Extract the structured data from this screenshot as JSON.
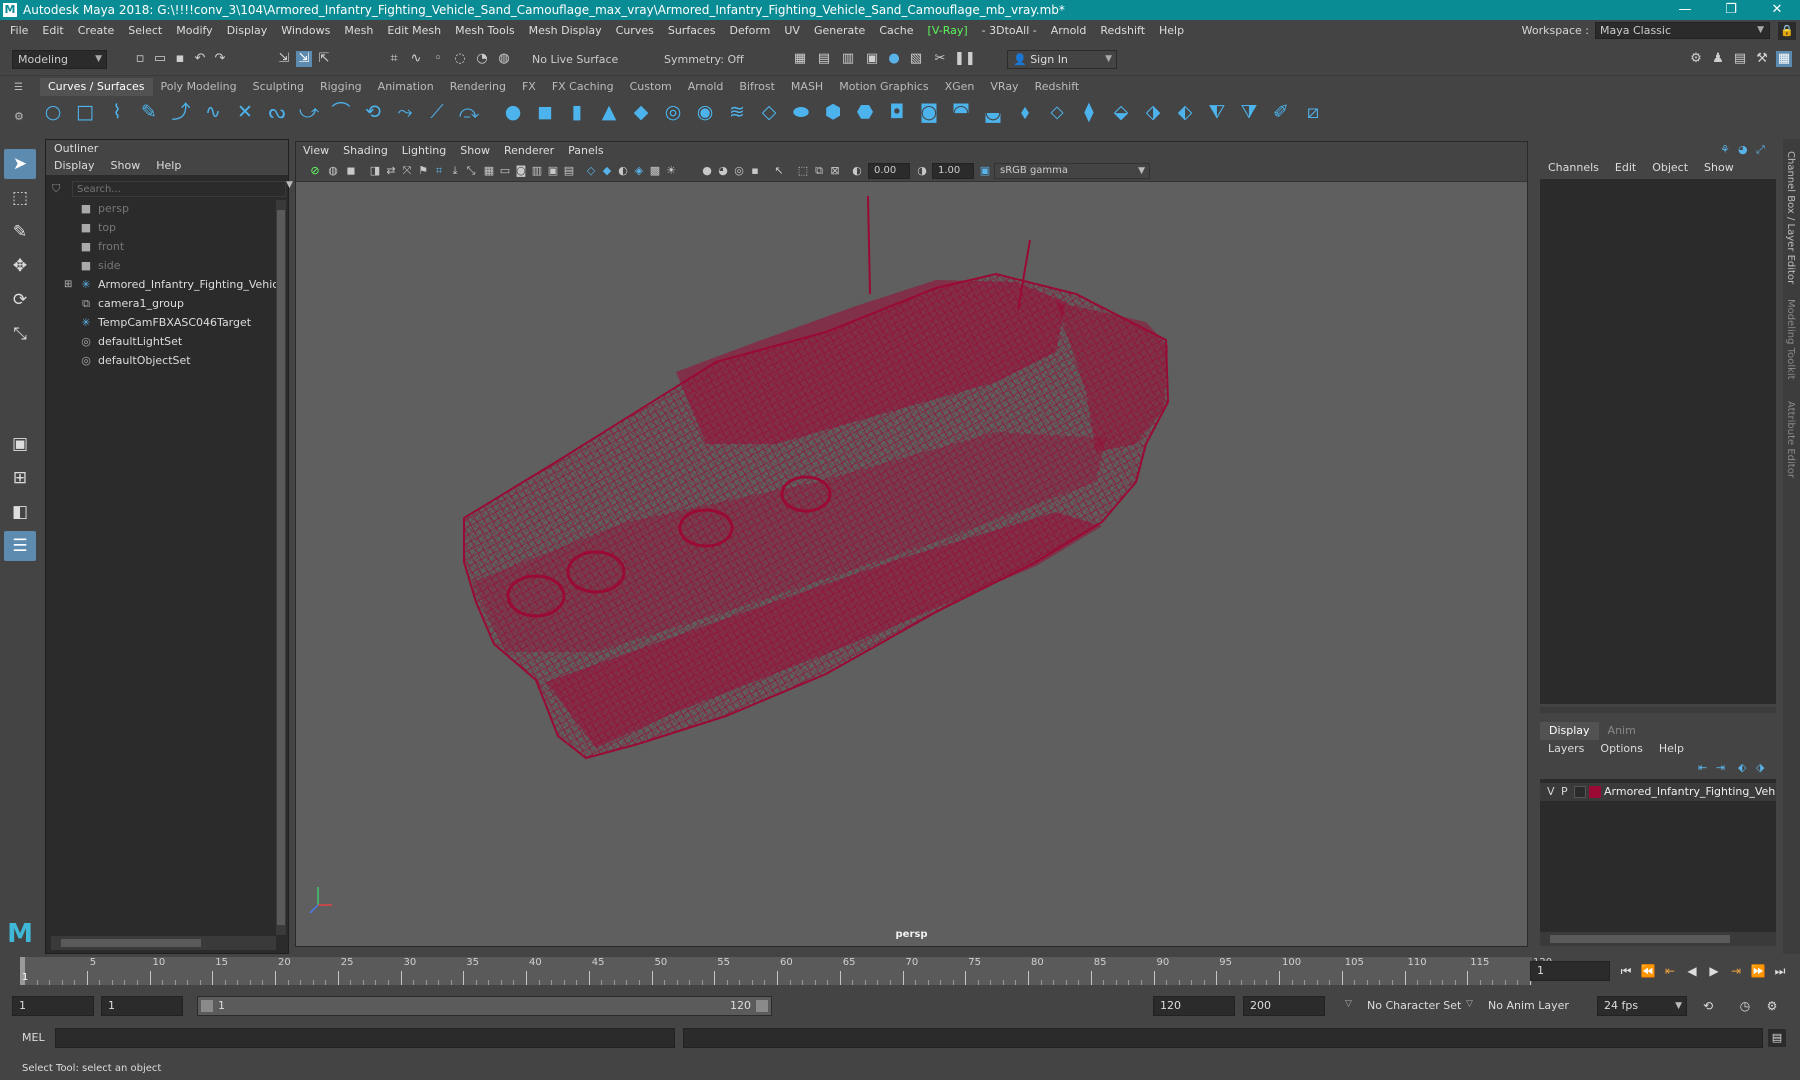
{
  "titlebar": {
    "logo": "M",
    "title": "Autodesk Maya 2018: G:\\!!!!conv_3\\104\\Armored_Infantry_Fighting_Vehicle_Sand_Camouflage_max_vray\\Armored_Infantry_Fighting_Vehicle_Sand_Camouflage_mb_vray.mb*",
    "minimize": "—",
    "restore": "❐",
    "close": "✕"
  },
  "menubar": {
    "items": [
      "File",
      "Edit",
      "Create",
      "Select",
      "Modify",
      "Display",
      "Windows",
      "Mesh",
      "Edit Mesh",
      "Mesh Tools",
      "Mesh Display",
      "Curves",
      "Surfaces",
      "Deform",
      "UV",
      "Generate",
      "Cache",
      "V-Ray",
      "3DtoAll",
      "Arnold",
      "Redshift",
      "Help"
    ],
    "workspace_label": "Workspace :",
    "workspace_value": "Maya Classic"
  },
  "statusline": {
    "menuset": "Modeling",
    "live_surface": "No Live Surface",
    "symmetry": "Symmetry: Off",
    "sign_in": "Sign In"
  },
  "shelf": {
    "tabs": [
      "Curves / Surfaces",
      "Poly Modeling",
      "Sculpting",
      "Rigging",
      "Animation",
      "Rendering",
      "FX",
      "FX Caching",
      "Custom",
      "Arnold",
      "Bifrost",
      "MASH",
      "Motion Graphics",
      "XGen",
      "VRay",
      "Redshift"
    ],
    "active_tab": "Curves / Surfaces"
  },
  "outliner": {
    "title": "Outliner",
    "menu": [
      "Display",
      "Show",
      "Help"
    ],
    "search_placeholder": "Search...",
    "items": [
      {
        "label": "persp",
        "icon": "camera-icon",
        "dim": true
      },
      {
        "label": "top",
        "icon": "camera-icon",
        "dim": true
      },
      {
        "label": "front",
        "icon": "camera-icon",
        "dim": true
      },
      {
        "label": "side",
        "icon": "camera-icon",
        "dim": true
      },
      {
        "label": "Armored_Infantry_Fighting_Vehicle_Sand_Camouflage",
        "icon": "transform-star-icon",
        "dim": false,
        "expandable": true
      },
      {
        "label": "camera1_group",
        "icon": "group-icon",
        "dim": false
      },
      {
        "label": "TempCamFBXASC046Target",
        "icon": "transform-star-icon",
        "dim": false
      },
      {
        "label": "defaultLightSet",
        "icon": "set-icon",
        "dim": false
      },
      {
        "label": "defaultObjectSet",
        "icon": "set-icon",
        "dim": false
      }
    ]
  },
  "viewport": {
    "menu": [
      "View",
      "Shading",
      "Lighting",
      "Show",
      "Renderer",
      "Panels"
    ],
    "exposure": "0.00",
    "gamma": "1.00",
    "colorspace": "sRGB gamma",
    "camera_label": "persp",
    "wire_color": "#9a0a34"
  },
  "channelbox": {
    "menu": [
      "Channels",
      "Edit",
      "Object",
      "Show"
    ],
    "tabs": [
      "Display",
      "Anim"
    ],
    "active_tab": "Display",
    "layer_menu": [
      "Layers",
      "Options",
      "Help"
    ],
    "layer": {
      "v": "V",
      "p": "P",
      "name": "Armored_Infantry_Fighting_Vehicle_Sand_Camouflage",
      "color": "#9a0a34"
    }
  },
  "side_tabs": [
    "Channel Box / Layer Editor",
    "Modeling Toolkit",
    "Attribute Editor"
  ],
  "timeslider": {
    "ticks": [
      "5",
      "10",
      "15",
      "20",
      "25",
      "30",
      "35",
      "40",
      "45",
      "50",
      "55",
      "60",
      "65",
      "70",
      "75",
      "80",
      "85",
      "90",
      "95",
      "100",
      "105",
      "110",
      "115",
      "120"
    ],
    "start_tick": "1",
    "current_frame": "1"
  },
  "rangeslider": {
    "start": "1",
    "playback_start": "1",
    "range_start": "1",
    "range_end": "120",
    "playback_end": "120",
    "end": "200",
    "character_set": "No Character Set",
    "anim_layer": "No Anim Layer",
    "fps": "24 fps"
  },
  "cmdline": {
    "label": "MEL"
  },
  "helpline": {
    "text": "Select Tool: select an object"
  }
}
